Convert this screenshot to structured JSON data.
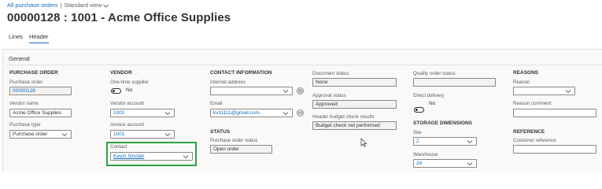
{
  "breadcrumb": {
    "link": "All purchase orders",
    "separator": "|",
    "view": "Standard view"
  },
  "page_title": "00000128 : 1001 - Acme Office Supplies",
  "tabs": [
    {
      "label": "Lines"
    },
    {
      "label": "Header"
    }
  ],
  "panel": {
    "title": "General"
  },
  "purchase_order": {
    "heading": "PURCHASE ORDER",
    "po_label": "Purchase order",
    "po_value": "00000128",
    "vendor_name_label": "Vendor name",
    "vendor_name_value": "Acme Office Supplies",
    "type_label": "Purchase type",
    "type_value": "Purchase order"
  },
  "vendor": {
    "heading": "VENDOR",
    "one_time_label": "One-time supplier",
    "one_time_value": "No",
    "account_label": "Vendor account",
    "account_value": "1001",
    "invoice_label": "Invoice account",
    "invoice_value": "1001",
    "contact_label": "Contact",
    "contact_value": "Kevin Sinclair"
  },
  "contact": {
    "heading": "CONTACT INFORMATION",
    "internet_label": "Internet address",
    "internet_value": "",
    "email_label": "Email",
    "email_value": "kv11111@gmail.com"
  },
  "status": {
    "heading": "STATUS",
    "po_status_label": "Purchase order status",
    "po_status_value": "Open order"
  },
  "document": {
    "doc_status_label": "Document status",
    "doc_status_value": "None",
    "approval_label": "Approval status",
    "approval_value": "Approved",
    "budget_label": "Header budget check results",
    "budget_value": "Budget check not performed"
  },
  "quality": {
    "label": "Quality order status",
    "value": "",
    "direct_label": "Direct delivery",
    "direct_value": "No"
  },
  "storage": {
    "heading": "STORAGE DIMENSIONS",
    "site_label": "Site",
    "site_value": "2",
    "warehouse_label": "Warehouse",
    "warehouse_value": "24"
  },
  "reasons": {
    "heading": "REASONS",
    "reason_label": "Reason",
    "reason_value": "",
    "comment_label": "Reason comment",
    "comment_value": ""
  },
  "reference": {
    "heading": "REFERENCE",
    "customer_ref_label": "Customer reference",
    "customer_ref_value": ""
  },
  "colors": {
    "accent": "#0f6cbd",
    "highlight": "#2ea043"
  }
}
